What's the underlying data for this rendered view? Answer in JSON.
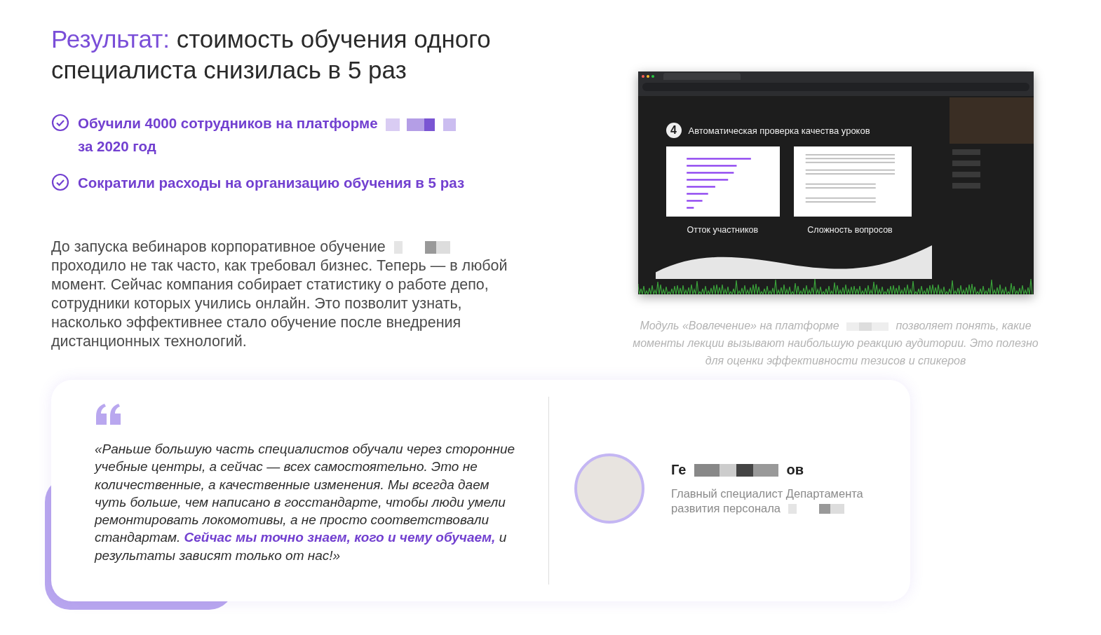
{
  "heading": "**Результат:** стоимость обучения одного специалиста снизилась в 5 раз",
  "achievements": [
    {
      "parts": [
        {
          "kind": "text",
          "text": "Обучили 4000 сотрудников на платформе"
        },
        {
          "kind": "redacted"
        },
        {
          "kind": "text",
          "text": "за 2020 год"
        }
      ]
    },
    {
      "parts": [
        {
          "kind": "text",
          "text": "Сократили расходы на организацию обучения в 5 раз"
        }
      ]
    }
  ],
  "description": [
    {
      "kind": "text",
      "text": "До запуска вебинаров корпоративное обучение"
    },
    {
      "kind": "redacted"
    },
    {
      "kind": "text",
      "text": "проходило не так часто, как требовал бизнес. Теперь — в любой момент. Сейчас компания собирает статистику о работе депо, сотрудники которых учились онлайн. Это позволит узнать, насколько эффективнее стало обучение после внедрения дистанционных технологий."
    }
  ],
  "webinar_screenshot": {
    "slide_number": "4",
    "slide_title": "Автоматическая проверка качества уроков",
    "labels": [
      "Отток участников",
      "Сложность вопросов"
    ]
  },
  "caption": [
    {
      "kind": "text",
      "text": "Модуль «Вовлечение» на платформе"
    },
    {
      "kind": "redacted"
    },
    {
      "kind": "text",
      "text": "позволяет понять, какие моменты лекции вызывают наибольшую реакцию аудитории. Это полезно для оценки эффективности тезисов и спикеров"
    }
  ],
  "testimonial": {
    "quote": "«Раньше большую часть специалистов обучали через сторонние учебные центры, а сейчас — всех самостоятельно. Это не количественные, а качественные изменения. Мы всегда даем чуть больше, чем написано в госстандарте, чтобы люди умели ремонтировать локомотивы, а не просто соответствовали стандартам. **Сейчас мы точно знаем, кого и чему обучаем,** и результаты зависят только от нас!»",
    "author": [
      {
        "kind": "text",
        "text": "Ге"
      },
      {
        "kind": "redacted"
      },
      {
        "kind": "text",
        "text": "ов"
      }
    ],
    "role": [
      {
        "kind": "text",
        "text": "Главный специалист Департамента развития персонала"
      },
      {
        "kind": "redacted"
      }
    ]
  }
}
